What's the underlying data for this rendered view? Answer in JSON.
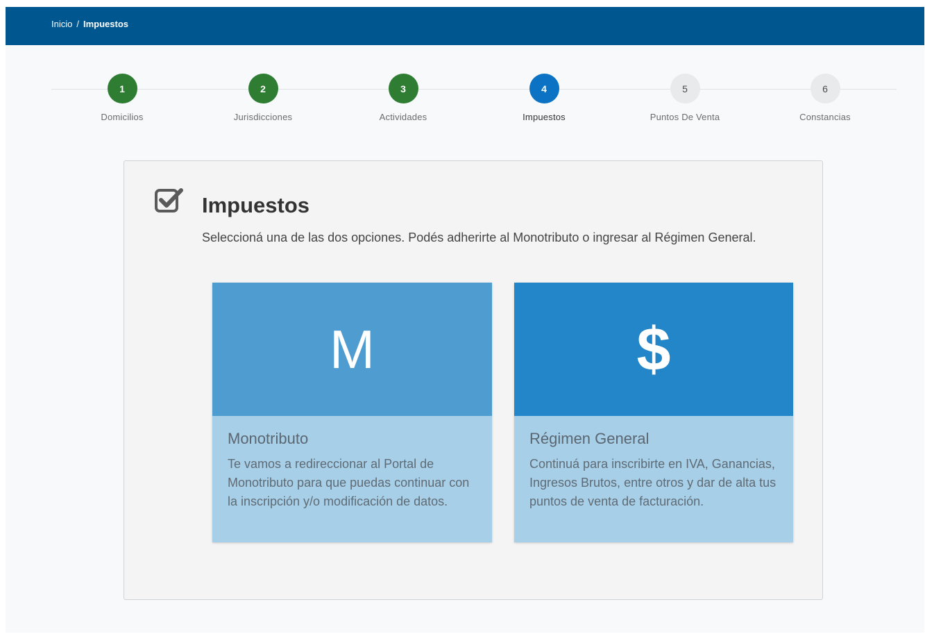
{
  "breadcrumb": {
    "home": "Inicio",
    "separator": "/",
    "current": "Impuestos"
  },
  "stepper": {
    "steps": [
      {
        "number": "1",
        "label": "Domicilios",
        "state": "done"
      },
      {
        "number": "2",
        "label": "Jurisdicciones",
        "state": "done"
      },
      {
        "number": "3",
        "label": "Actividades",
        "state": "done"
      },
      {
        "number": "4",
        "label": "Impuestos",
        "state": "active"
      },
      {
        "number": "5",
        "label": "Puntos De Venta",
        "state": "pending"
      },
      {
        "number": "6",
        "label": "Constancias",
        "state": "pending"
      }
    ]
  },
  "main": {
    "icon": "checkbox-checked-icon",
    "title": "Impuestos",
    "description": "Seleccioná una de las dos opciones. Podés adherirte al Monotributo o ingresar al Régimen General.",
    "options": [
      {
        "symbol": "M",
        "title": "Monotributo",
        "text": "Te vamos a redireccionar al Portal de Monotributo para que puedas continuar con la inscripción y/o modificación de datos."
      },
      {
        "symbol": "$",
        "icon": "dollar-icon",
        "title": "Régimen General",
        "text": "Continuá para inscribirte en IVA, Ganancias, Ingresos Brutos, entre otros y dar de alta tus puntos de venta de facturación."
      }
    ]
  },
  "colors": {
    "topbar": "#00568f",
    "step_done": "#2e7d32",
    "step_active": "#0b72c4",
    "step_pending": "#e8eaeb",
    "mono_header": "#4e9cd0",
    "general_header": "#2386c8",
    "option_body": "#a8cfe8"
  }
}
